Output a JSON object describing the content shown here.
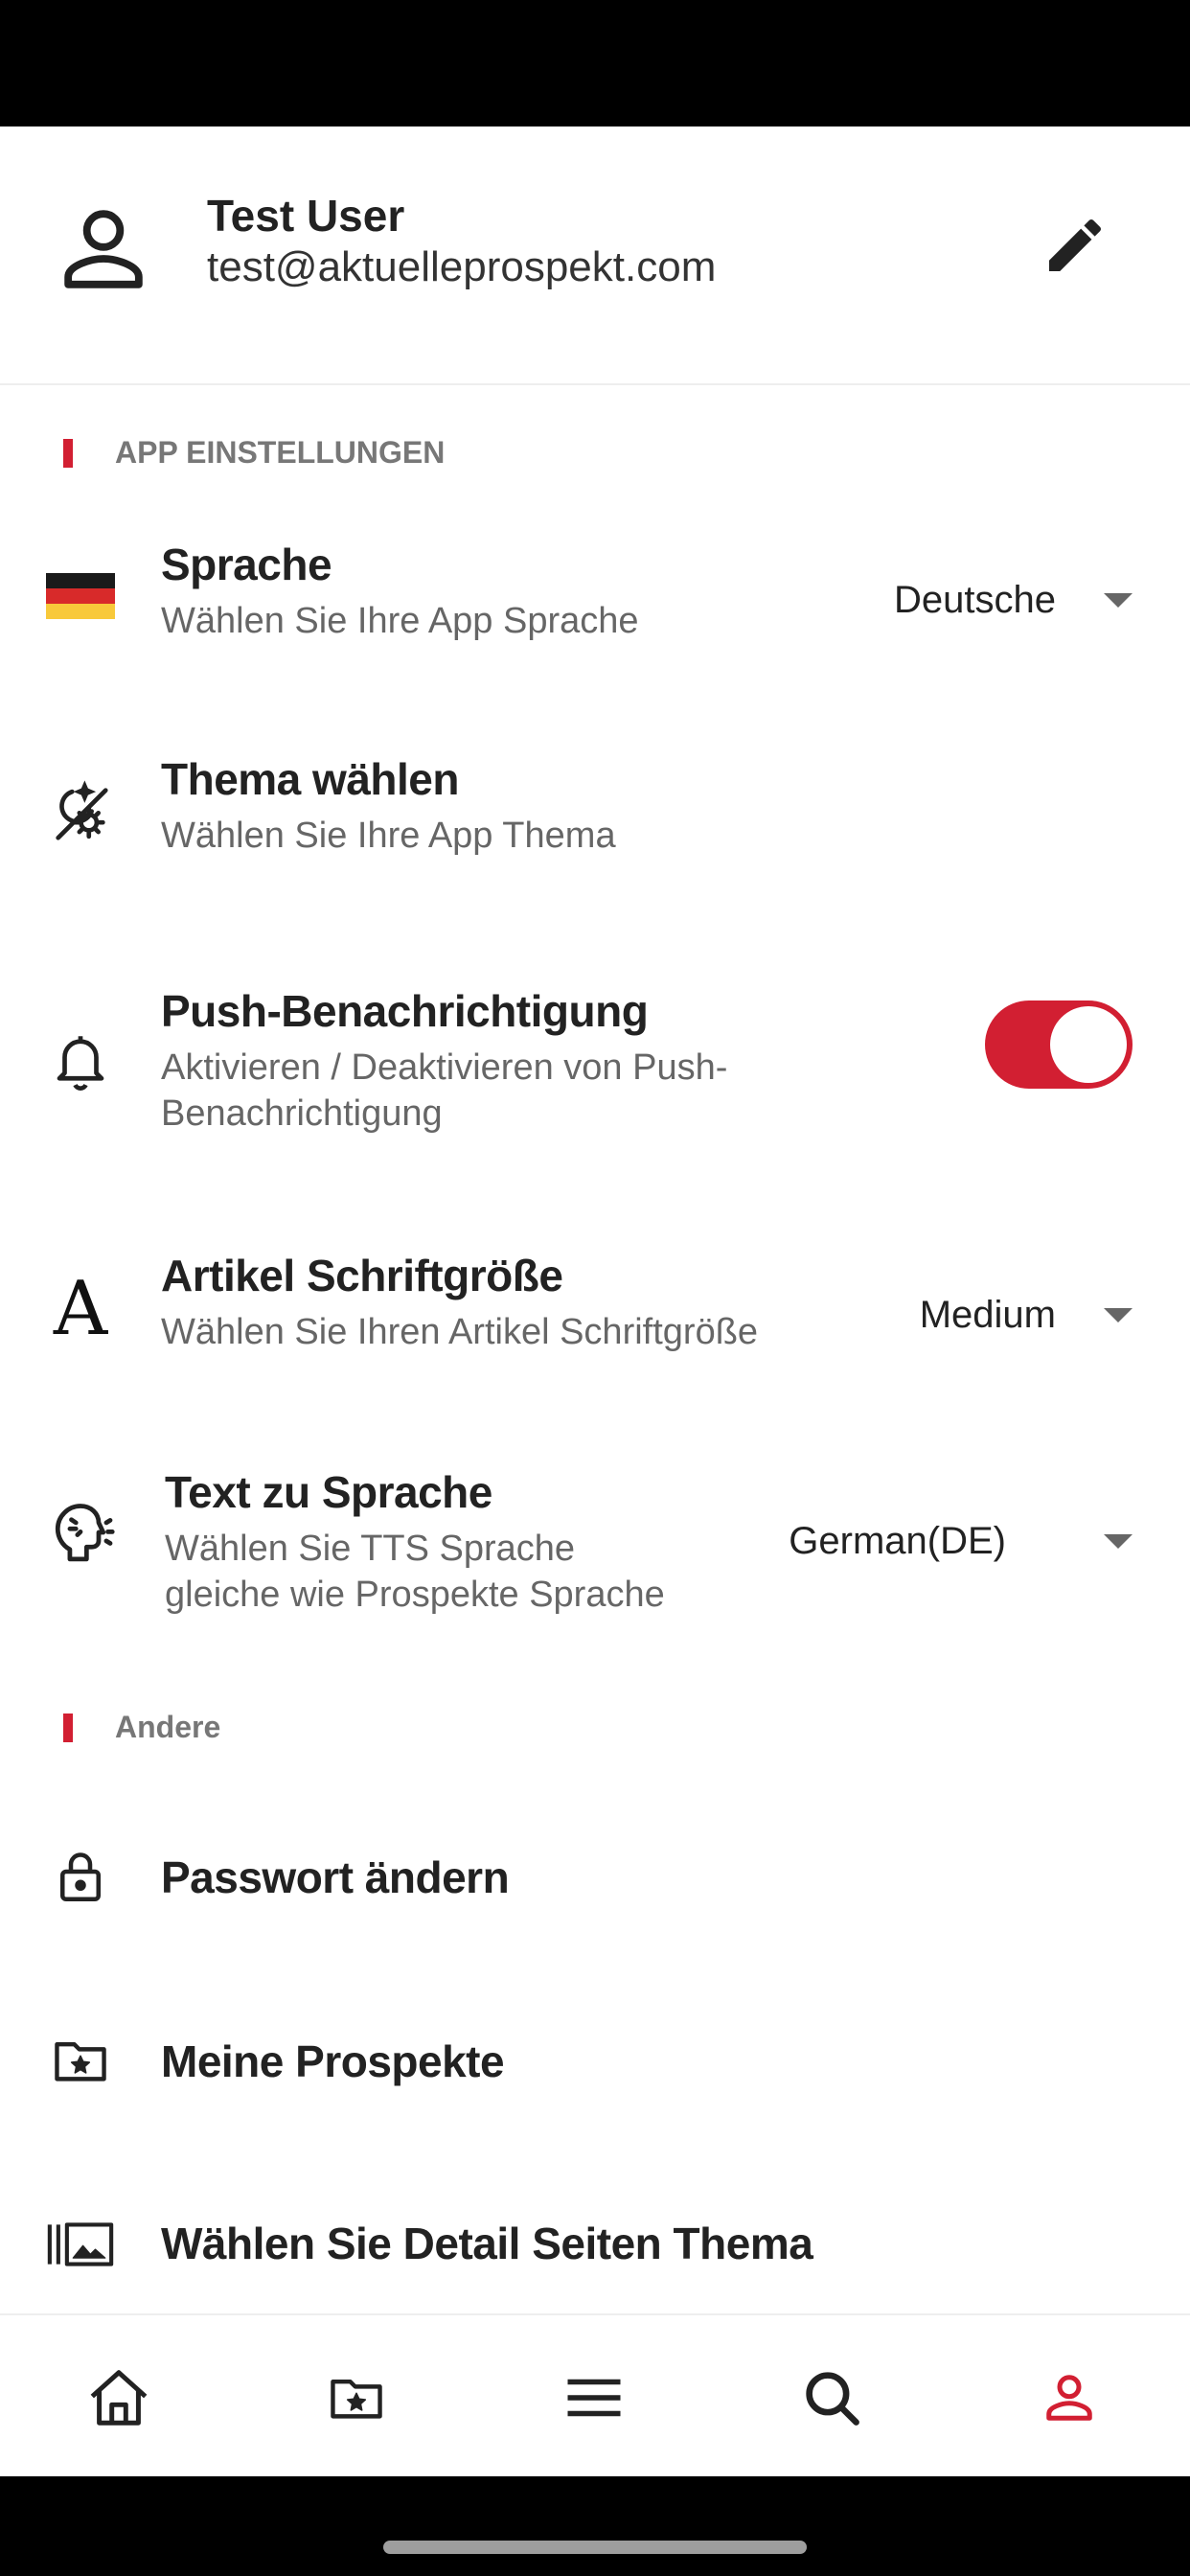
{
  "profile": {
    "name": "Test User",
    "email": "test@aktuelleprospekt.com"
  },
  "sections": {
    "app_settings": "APP EINSTELLUNGEN",
    "other": "Andere"
  },
  "settings": {
    "language": {
      "label": "Sprache",
      "sub": "Wählen Sie Ihre App Sprache",
      "value": "Deutsche"
    },
    "theme": {
      "label": "Thema wählen",
      "sub": "Wählen Sie Ihre App Thema"
    },
    "push": {
      "label": "Push-Benachrichtigung",
      "sub_line1": "Aktivieren / Deaktivieren von Push-",
      "sub_line2": "Benachrichtigung",
      "enabled": true
    },
    "font_size": {
      "label": "Artikel Schriftgröße",
      "sub": "Wählen Sie Ihren Artikel Schriftgröße",
      "value": "Medium"
    },
    "tts": {
      "label": "Text zu Sprache",
      "sub_line1": "Wählen Sie TTS Sprache",
      "sub_line2": "gleiche wie Prospekte Sprache",
      "value": "German(DE)"
    }
  },
  "other": {
    "password": "Passwort ändern",
    "my_flyers": "Meine Prospekte",
    "detail_theme": "Wählen Sie Detail Seiten Thema"
  },
  "colors": {
    "accent": "#d21f32",
    "text": "#222222",
    "subtext": "#666666"
  },
  "nav": {
    "items": [
      "home-icon",
      "folder-star-icon",
      "menu-icon",
      "search-icon",
      "profile-icon"
    ],
    "active": "profile-icon"
  }
}
